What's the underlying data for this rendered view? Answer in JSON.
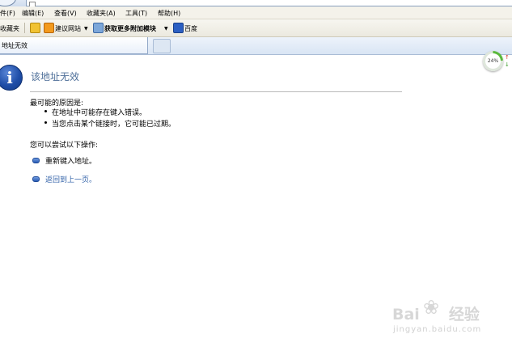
{
  "menu": {
    "items": [
      "件(F)",
      "编辑(E)",
      "查看(V)",
      "收藏夹(A)",
      "工具(T)",
      "帮助(H)"
    ]
  },
  "favorites_bar": {
    "favorites_label": "收藏夹",
    "items": [
      {
        "label": "建议网站",
        "icon": "suggested-sites-icon"
      },
      {
        "label": "获取更多附加模块",
        "icon": "addons-icon"
      },
      {
        "label": "百度",
        "icon": "baidu-icon"
      }
    ]
  },
  "tab": {
    "title": "地址无效"
  },
  "error_page": {
    "title": "该地址无效",
    "reasons_heading": "最可能的原因是:",
    "reasons": [
      "在地址中可能存在键入错误。",
      "当您点击某个链接时，它可能已过期。"
    ],
    "actions_heading": "您可以尝试以下操作:",
    "actions": [
      "重新键入地址。",
      "返回到上一页。"
    ]
  },
  "progress": {
    "percent": 24,
    "label": "24%"
  },
  "watermark": {
    "brand_left": "Bai",
    "brand_right": "经验",
    "url": "jingyan.baidu.com"
  },
  "colors": {
    "title": "#4d6e98",
    "link": "#3262a8",
    "accent": "#1f4ea8"
  }
}
